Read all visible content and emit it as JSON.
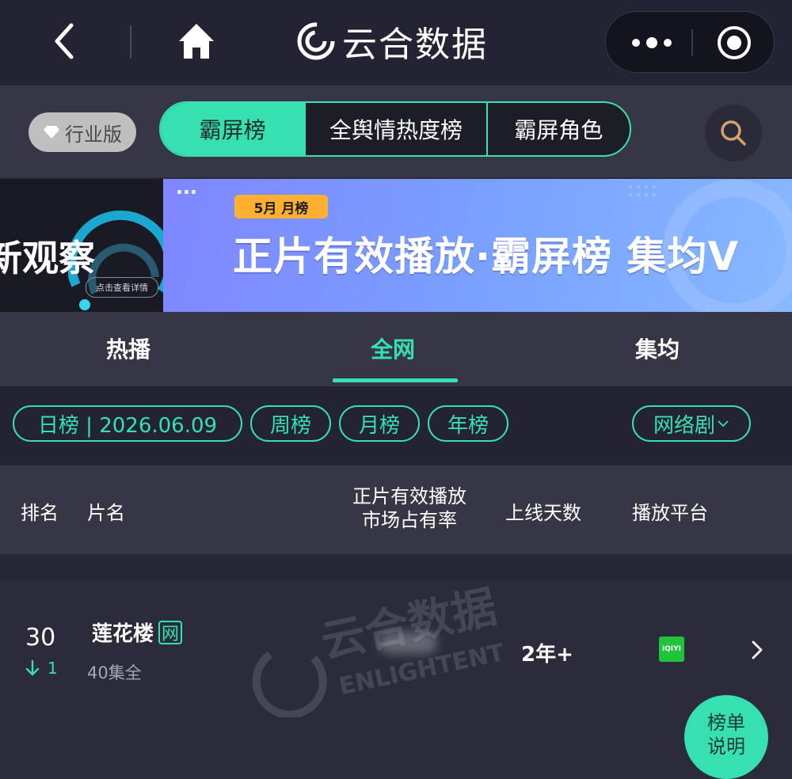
{
  "header": {
    "app_title": "云合数据"
  },
  "toolbar": {
    "industry_badge": "行业版",
    "segments": [
      "霸屏榜",
      "全舆情热度榜",
      "霸屏角色"
    ]
  },
  "banner": {
    "left_text": "新观察",
    "left_button": "点击查看详情",
    "tag": "5月 月榜",
    "headline": "正片有效播放·霸屏榜 集均V"
  },
  "tabs": [
    "热播",
    "全网",
    "集均"
  ],
  "active_tab": "全网",
  "filters": {
    "date_chip": "日榜 | 2026.06.09",
    "period_chips": [
      "周榜",
      "月榜",
      "年榜"
    ],
    "category": "网络剧"
  },
  "table": {
    "headers": {
      "rank": "排名",
      "name": "片名",
      "share_line1": "正片有效播放",
      "share_line2": "市场占有率",
      "days": "上线天数",
      "platform": "播放平台"
    },
    "rows": [
      {
        "rank": "30",
        "change": "1",
        "change_direction": "down",
        "title": "莲花楼",
        "network_tag": "网",
        "episodes": "40集全",
        "days_online": "2年+",
        "platform": "iQIYI"
      }
    ]
  },
  "watermark": {
    "cn": "云合数据",
    "en": "ENLIGHTENT"
  },
  "fab": {
    "line1": "榜单",
    "line2": "说明"
  },
  "colors": {
    "accent": "#36e0b0",
    "background": "#2b2b3b",
    "topbar": "#232333",
    "banner_tag": "#ffb030",
    "iqiyi": "#1fc43a"
  }
}
